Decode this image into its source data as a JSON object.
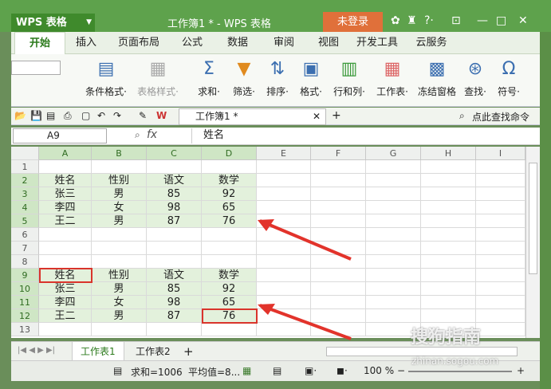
{
  "app": {
    "name": "WPS 表格",
    "window_title": "工作簿1 * - WPS 表格",
    "login_label": "未登录"
  },
  "menus": [
    "开始",
    "插入",
    "页面布局",
    "公式",
    "数据",
    "审阅",
    "视图",
    "开发工具",
    "云服务"
  ],
  "ribbon": {
    "conditional_format": "条件格式·",
    "table_style": "表格样式·",
    "sum": "求和·",
    "filter": "筛选·",
    "sort": "排序·",
    "format": "格式·",
    "row_col": "行和列·",
    "worksheet": "工作表·",
    "freeze": "冻结窗格",
    "find": "查找·",
    "symbol": "符号·"
  },
  "quick_access": {
    "doc_tab": "工作簿1 *",
    "search_cmd": "点此查找命令"
  },
  "formula_bar": {
    "name_box": "A9",
    "fx": "fx",
    "value": "姓名"
  },
  "columns": [
    "A",
    "B",
    "C",
    "D",
    "E",
    "F",
    "G",
    "H",
    "I"
  ],
  "rows": [
    "1",
    "2",
    "3",
    "4",
    "5",
    "6",
    "7",
    "8",
    "9",
    "10",
    "11",
    "12",
    "13"
  ],
  "table1": [
    [
      "姓名",
      "性别",
      "语文",
      "数学"
    ],
    [
      "张三",
      "男",
      "85",
      "92"
    ],
    [
      "李四",
      "女",
      "98",
      "65"
    ],
    [
      "王二",
      "男",
      "87",
      "76"
    ]
  ],
  "table2": [
    [
      "姓名",
      "性别",
      "语文",
      "数学"
    ],
    [
      "张三",
      "男",
      "85",
      "92"
    ],
    [
      "李四",
      "女",
      "98",
      "65"
    ],
    [
      "王二",
      "男",
      "87",
      "76"
    ]
  ],
  "sheets": [
    "工作表1",
    "工作表2"
  ],
  "status": {
    "sum": "求和=1006",
    "avg": "平均值=8...",
    "zoom": "100 %"
  },
  "watermark": {
    "brand": "搜狗指南",
    "url": "zhinan.sogou.com"
  },
  "colors": {
    "title_green": "#5ea24c",
    "highlight": "#e3f1dc",
    "red": "#d9342b"
  }
}
